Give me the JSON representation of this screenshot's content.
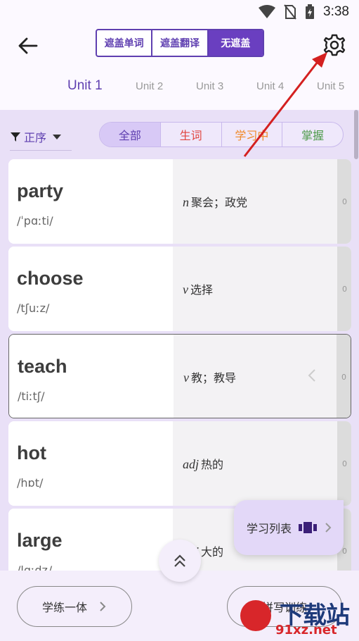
{
  "status": {
    "time": "3:38"
  },
  "header": {
    "segments": [
      {
        "label": "遮盖单词"
      },
      {
        "label": "遮盖翻译"
      },
      {
        "label": "无遮盖"
      }
    ],
    "units": [
      {
        "label": "Unit 1"
      },
      {
        "label": "Unit 2"
      },
      {
        "label": "Unit 3"
      },
      {
        "label": "Unit 4"
      },
      {
        "label": "Unit 5"
      }
    ]
  },
  "sort": {
    "label": "正序"
  },
  "filters": [
    {
      "label": "全部",
      "color": "#5f3fb0"
    },
    {
      "label": "生词",
      "color": "#e0453f"
    },
    {
      "label": "学习中",
      "color": "#f08a2a"
    },
    {
      "label": "掌握",
      "color": "#4d9a4a"
    }
  ],
  "words": [
    {
      "word": "party",
      "phonetic": "/ˈpɑːti/",
      "pos": "n",
      "meaning": "聚会；政党",
      "count": "0"
    },
    {
      "word": "choose",
      "phonetic": "/tʃuːz/",
      "pos": "v",
      "meaning": "选择",
      "count": "0"
    },
    {
      "word": "teach",
      "phonetic": "/tiːtʃ/",
      "pos": "v",
      "meaning": "教；教导",
      "count": "0"
    },
    {
      "word": "hot",
      "phonetic": "/hɒt/",
      "pos": "adj",
      "meaning": "热的",
      "count": "0"
    },
    {
      "word": "large",
      "phonetic": "/lɑːdʒ/",
      "pos": "adj",
      "meaning": "大的",
      "count": "0"
    }
  ],
  "study_list": {
    "label": "学习列表"
  },
  "bottom": {
    "practice_label": "学练一体",
    "spelling_label": "拼写训练"
  },
  "watermark": {
    "text": "下载站",
    "url": "91xz.net"
  },
  "colors": {
    "accent": "#5f3fb0",
    "content_bg": "#e9e0f7",
    "annotation_arrow": "#d42020"
  }
}
